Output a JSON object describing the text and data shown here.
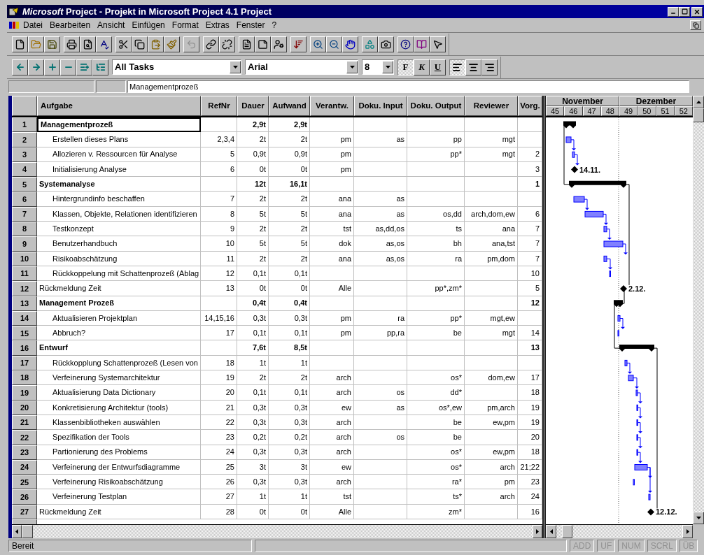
{
  "window": {
    "title": "**Microsoft** Project - Projekt in Microsoft Project 4.1 Project"
  },
  "menu": [
    "Datei",
    "Bearbeiten",
    "Ansicht",
    "Einfügen",
    "Format",
    "Extras",
    "Fenster",
    "?"
  ],
  "toolbar_standard": {
    "groups": [
      {
        "buttons": [
          {
            "kind": "new",
            "disabled": false
          },
          {
            "kind": "open",
            "disabled": false
          },
          {
            "kind": "save",
            "disabled": false
          }
        ]
      },
      {
        "buttons": [
          {
            "kind": "print",
            "disabled": false
          },
          {
            "kind": "preview",
            "disabled": false
          },
          {
            "kind": "spelling",
            "disabled": false
          }
        ]
      },
      {
        "buttons": [
          {
            "kind": "cut",
            "disabled": false
          },
          {
            "kind": "copy",
            "disabled": false
          },
          {
            "kind": "paste",
            "disabled": false
          },
          {
            "kind": "format_painter",
            "disabled": false
          }
        ]
      },
      {
        "buttons": [
          {
            "kind": "undo",
            "disabled": true
          }
        ]
      },
      {
        "buttons": [
          {
            "kind": "link",
            "disabled": false
          },
          {
            "kind": "unlink",
            "disabled": false
          }
        ]
      },
      {
        "buttons": [
          {
            "kind": "task_info",
            "disabled": false
          },
          {
            "kind": "notes",
            "disabled": false
          },
          {
            "kind": "resource",
            "disabled": false
          }
        ]
      },
      {
        "buttons": [
          {
            "kind": "sort",
            "disabled": false
          }
        ]
      },
      {
        "buttons": [
          {
            "kind": "zoom_in",
            "disabled": false
          },
          {
            "kind": "zoom_out",
            "disabled": false
          },
          {
            "kind": "goto",
            "disabled": false
          }
        ]
      },
      {
        "buttons": [
          {
            "kind": "wizard",
            "disabled": false
          },
          {
            "kind": "camera",
            "disabled": false
          }
        ]
      },
      {
        "buttons": [
          {
            "kind": "help",
            "disabled": false
          },
          {
            "kind": "book",
            "disabled": false
          },
          {
            "kind": "whats_this",
            "disabled": false
          }
        ]
      }
    ]
  },
  "toolbar_formatting": {
    "outline_buttons": [
      {
        "kind": "outdent"
      },
      {
        "kind": "indent"
      },
      {
        "kind": "show"
      },
      {
        "kind": "hide"
      },
      {
        "kind": "show_all"
      },
      {
        "kind": "symbols"
      }
    ],
    "dropdowns": [
      {
        "kind": "filter",
        "value": "All Tasks"
      },
      {
        "kind": "font",
        "value": "Arial"
      },
      {
        "kind": "size",
        "value": "8"
      }
    ],
    "style_buttons": [
      {
        "kind": "bold",
        "label": "F",
        "pressed": true
      },
      {
        "kind": "italic",
        "label": "K",
        "pressed": false
      },
      {
        "kind": "underline",
        "label": "U",
        "pressed": false
      }
    ],
    "align_buttons": [
      {
        "kind": "left",
        "pressed": true
      },
      {
        "kind": "center",
        "pressed": false
      },
      {
        "kind": "right",
        "pressed": false
      }
    ]
  },
  "entry_bar": {
    "value": "Managementprozeß"
  },
  "table": {
    "columns": [
      "Aufgabe",
      "RefNr",
      "Dauer",
      "Aufwand",
      "Verantw.",
      "Doku. Input",
      "Doku. Output",
      "Reviewer",
      "Vorg."
    ],
    "tasks": [
      {
        "id": "1",
        "name": "Managementprozeß",
        "dauer": "2,9t",
        "aufwand": "2,9t",
        "selected": true,
        "kind": "summary",
        "children": [
          {
            "id": "2",
            "name": "Erstellen dieses Plans",
            "refnr": "2,3,4",
            "dauer": "2t",
            "aufwand": "2t",
            "verantw": "pm",
            "doku_input": "as",
            "doku_output": "pp",
            "reviewer": "mgt",
            "selected": false,
            "kind": "task"
          },
          {
            "id": "3",
            "name": "Allozieren v. Ressourcen für Analyse",
            "refnr": "5",
            "dauer": "0,9t",
            "aufwand": "0,9t",
            "verantw": "pm",
            "doku_output": "pp*",
            "reviewer": "mgt",
            "vorg": "2",
            "selected": false,
            "kind": "task"
          },
          {
            "id": "4",
            "name": "Initialisierung Analyse",
            "refnr": "6",
            "dauer": "0t",
            "aufwand": "0t",
            "verantw": "pm",
            "vorg": "3",
            "selected": false,
            "kind": "milestone",
            "date_label": "14.11."
          }
        ]
      },
      {
        "id": "5",
        "name": "Systemanalyse",
        "dauer": "12t",
        "aufwand": "16,1t",
        "vorg": "1",
        "selected": false,
        "kind": "summary",
        "children": [
          {
            "id": "6",
            "name": "Hintergrundinfo beschaffen",
            "refnr": "7",
            "dauer": "2t",
            "aufwand": "2t",
            "verantw": "ana",
            "doku_input": "as",
            "selected": false,
            "kind": "task"
          },
          {
            "id": "7",
            "name": "Klassen, Objekte, Relationen identifizieren",
            "refnr": "8",
            "dauer": "5t",
            "aufwand": "5t",
            "verantw": "ana",
            "doku_input": "as",
            "doku_output": "os,dd",
            "reviewer": "arch,dom,ew",
            "vorg": "6",
            "selected": false,
            "kind": "task"
          },
          {
            "id": "8",
            "name": "Testkonzept",
            "refnr": "9",
            "dauer": "2t",
            "aufwand": "2t",
            "verantw": "tst",
            "doku_input": "as,dd,os",
            "doku_output": "ts",
            "reviewer": "ana",
            "vorg": "7",
            "selected": false,
            "kind": "task"
          },
          {
            "id": "9",
            "name": "Benutzerhandbuch",
            "refnr": "10",
            "dauer": "5t",
            "aufwand": "5t",
            "verantw": "dok",
            "doku_input": "as,os",
            "doku_output": "bh",
            "reviewer": "ana,tst",
            "vorg": "7",
            "selected": false,
            "kind": "task"
          },
          {
            "id": "10",
            "name": "Risikoabschätzung",
            "refnr": "11",
            "dauer": "2t",
            "aufwand": "2t",
            "verantw": "ana",
            "doku_input": "as,os",
            "doku_output": "ra",
            "reviewer": "pm,dom",
            "vorg": "7",
            "selected": false,
            "kind": "task"
          },
          {
            "id": "11",
            "name": "Rückkoppelung mit Schattenprozeß (Ablag",
            "refnr": "12",
            "dauer": "0,1t",
            "aufwand": "0,1t",
            "vorg": "10",
            "selected": false,
            "kind": "task"
          }
        ]
      },
      {
        "id": "12",
        "name": "Rückmeldung Zeit",
        "refnr": "13",
        "dauer": "0t",
        "aufwand": "0t",
        "verantw": "Alle",
        "doku_output": "pp*,zm*",
        "vorg": "5",
        "selected": false,
        "kind": "milestone",
        "date_label": "2.12."
      },
      {
        "id": "13",
        "name": "Management Prozeß",
        "dauer": "0,4t",
        "aufwand": "0,4t",
        "vorg": "12",
        "selected": false,
        "kind": "summary",
        "children": [
          {
            "id": "14",
            "name": "Aktualisieren Projektplan",
            "refnr": "14,15,16",
            "dauer": "0,3t",
            "aufwand": "0,3t",
            "verantw": "pm",
            "doku_input": "ra",
            "doku_output": "pp*",
            "reviewer": "mgt,ew",
            "selected": false,
            "kind": "task"
          },
          {
            "id": "15",
            "name": "Abbruch?",
            "refnr": "17",
            "dauer": "0,1t",
            "aufwand": "0,1t",
            "verantw": "pm",
            "doku_input": "pp,ra",
            "doku_output": "be",
            "reviewer": "mgt",
            "vorg": "14",
            "selected": false,
            "kind": "task"
          }
        ]
      },
      {
        "id": "16",
        "name": "Entwurf",
        "dauer": "7,6t",
        "aufwand": "8,5t",
        "vorg": "13",
        "selected": false,
        "kind": "summary",
        "children": [
          {
            "id": "17",
            "name": "Rückkopplung Schattenprozeß (Lesen von",
            "refnr": "18",
            "dauer": "1t",
            "aufwand": "1t",
            "selected": false,
            "kind": "task"
          },
          {
            "id": "18",
            "name": "Verfeinerung Systemarchitektur",
            "refnr": "19",
            "dauer": "2t",
            "aufwand": "2t",
            "verantw": "arch",
            "doku_output": "os*",
            "reviewer": "dom,ew",
            "vorg": "17",
            "selected": false,
            "kind": "task"
          },
          {
            "id": "19",
            "name": "Aktualisierung Data Dictionary",
            "refnr": "20",
            "dauer": "0,1t",
            "aufwand": "0,1t",
            "verantw": "arch",
            "doku_input": "os",
            "doku_output": "dd*",
            "vorg": "18",
            "selected": false,
            "kind": "task"
          },
          {
            "id": "20",
            "name": "Konkretisierung Architektur (tools)",
            "refnr": "21",
            "dauer": "0,3t",
            "aufwand": "0,3t",
            "verantw": "ew",
            "doku_input": "as",
            "doku_output": "os*,ew",
            "reviewer": "pm,arch",
            "vorg": "19",
            "selected": false,
            "kind": "task"
          },
          {
            "id": "21",
            "name": "Klassenbibliotheken auswählen",
            "refnr": "22",
            "dauer": "0,3t",
            "aufwand": "0,3t",
            "verantw": "arch",
            "doku_output": "be",
            "reviewer": "ew,pm",
            "vorg": "19",
            "selected": false,
            "kind": "task"
          },
          {
            "id": "22",
            "name": "Spezifikation der Tools",
            "refnr": "23",
            "dauer": "0,2t",
            "aufwand": "0,2t",
            "verantw": "arch",
            "doku_input": "os",
            "doku_output": "be",
            "vorg": "20",
            "selected": false,
            "kind": "task"
          },
          {
            "id": "23",
            "name": "Partionierung des Problems",
            "refnr": "24",
            "dauer": "0,3t",
            "aufwand": "0,3t",
            "verantw": "arch",
            "doku_output": "os*",
            "reviewer": "ew,pm",
            "vorg": "18",
            "selected": false,
            "kind": "task"
          },
          {
            "id": "24",
            "name": "Verfeinerung der Entwurfsdiagramme",
            "refnr": "25",
            "dauer": "3t",
            "aufwand": "3t",
            "verantw": "ew",
            "doku_output": "os*",
            "reviewer": "arch",
            "vorg": "21;22",
            "selected": false,
            "kind": "task"
          },
          {
            "id": "25",
            "name": "Verfeinerung Risikoabschätzung",
            "refnr": "26",
            "dauer": "0,3t",
            "aufwand": "0,3t",
            "verantw": "arch",
            "doku_output": "ra*",
            "reviewer": "pm",
            "vorg": "23",
            "selected": false,
            "kind": "task"
          },
          {
            "id": "26",
            "name": "Verfeinerung Testplan",
            "refnr": "27",
            "dauer": "1t",
            "aufwand": "1t",
            "verantw": "tst",
            "doku_output": "ts*",
            "reviewer": "arch",
            "vorg": "24",
            "selected": false,
            "kind": "task"
          }
        ]
      },
      {
        "id": "27",
        "name": "Rückmeldung Zeit",
        "refnr": "28",
        "dauer": "0t",
        "aufwand": "0t",
        "verantw": "Alle",
        "doku_output": "zm*",
        "vorg": "16",
        "selected": false,
        "kind": "milestone",
        "date_label": "12.12."
      }
    ]
  },
  "gantt": {
    "months": [
      "November",
      "Dezember"
    ],
    "weeks": [
      "45",
      "46",
      "47",
      "48",
      "49",
      "50",
      "51",
      "52"
    ]
  },
  "status_bar": {
    "text": "Bereit",
    "indicators": [
      {
        "label": "ADD",
        "on": false
      },
      {
        "label": "UF",
        "on": false
      },
      {
        "label": "NUM",
        "on": false
      },
      {
        "label": "SCRL",
        "on": false
      },
      {
        "label": "ÜB",
        "on": false
      }
    ]
  }
}
